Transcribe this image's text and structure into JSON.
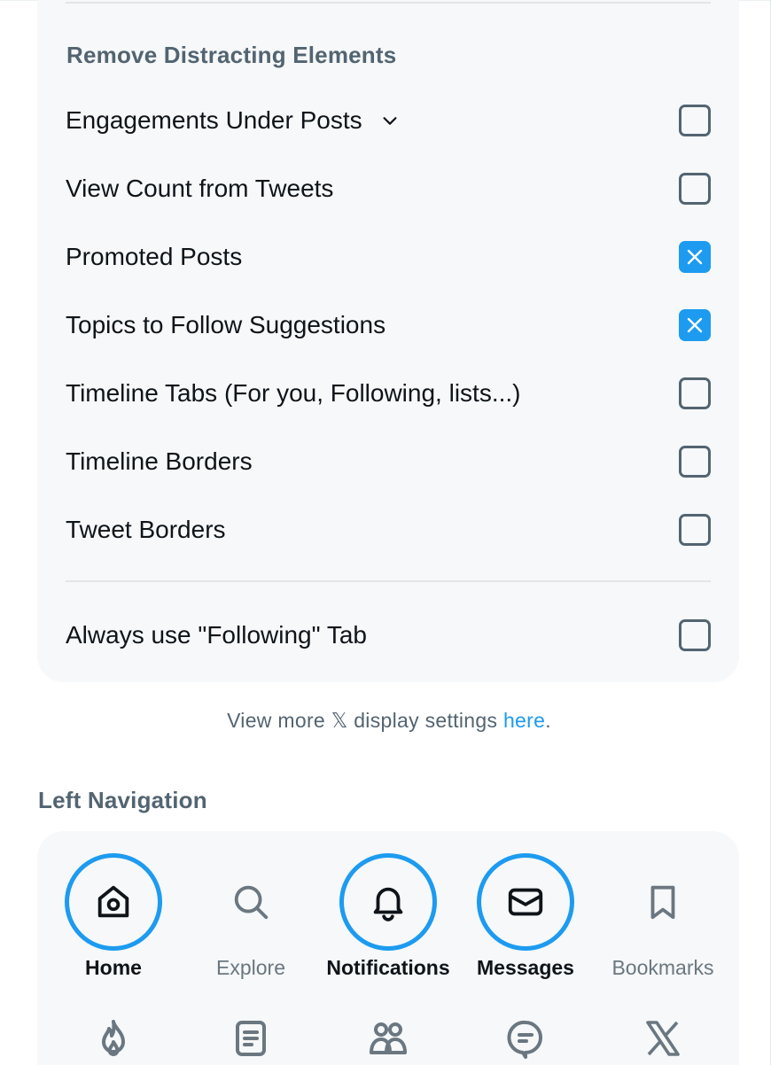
{
  "distracting": {
    "heading": "Remove Distracting Elements",
    "items": [
      {
        "label": "Engagements Under Posts",
        "checked": false,
        "expandable": true
      },
      {
        "label": "View Count from Tweets",
        "checked": false
      },
      {
        "label": "Promoted Posts",
        "checked": true
      },
      {
        "label": "Topics to Follow Suggestions",
        "checked": true
      },
      {
        "label": "Timeline Tabs (For you, Following, lists...)",
        "checked": false
      },
      {
        "label": "Timeline Borders",
        "checked": false
      },
      {
        "label": "Tweet Borders",
        "checked": false
      }
    ],
    "following_tab": {
      "label": "Always use \"Following\" Tab",
      "checked": false
    }
  },
  "display_note": {
    "prefix": "View more 𝕏 display settings ",
    "link": "here",
    "suffix": "."
  },
  "left_navigation": {
    "heading": "Left Navigation",
    "items": [
      {
        "label": "Home",
        "icon": "home-icon",
        "active": true
      },
      {
        "label": "Explore",
        "icon": "search-icon",
        "active": false
      },
      {
        "label": "Notifications",
        "icon": "bell-icon",
        "active": true
      },
      {
        "label": "Messages",
        "icon": "envelope-icon",
        "active": true
      },
      {
        "label": "Bookmarks",
        "icon": "bookmark-icon",
        "active": false
      }
    ],
    "row2_icons": [
      "flame-icon",
      "article-icon",
      "communities-icon",
      "chat-bubble-icon",
      "x-logo-icon"
    ]
  },
  "colors": {
    "accent": "#1d9bf0",
    "panel": "#f6f8f9",
    "muted_text": "#536471",
    "text": "#0f1419"
  }
}
